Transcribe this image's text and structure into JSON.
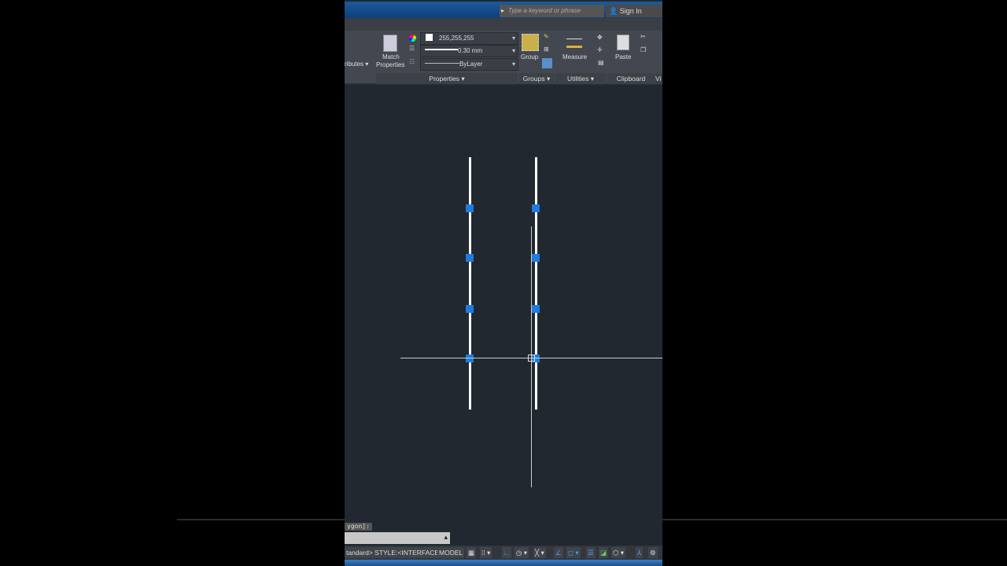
{
  "title_bar": {
    "search_placeholder": "Type a keyword or phrase",
    "sign_in": "Sign In"
  },
  "ribbon": {
    "attributes_partial": "ributes",
    "match_properties": [
      "Match",
      "Properties"
    ],
    "color_value": "255,255,255",
    "lineweight_value": "0.30 mm",
    "linetype_value": "ByLayer",
    "group_label": "Group",
    "measure_label": "Measure",
    "paste_label": "Paste",
    "panels": [
      "Properties",
      "Groups",
      "Utilities",
      "Clipboard",
      "Vi"
    ]
  },
  "command_line": {
    "prompt": "ygon]:",
    "input": ""
  },
  "status_bar": {
    "style_text": "tandard> STYLE:<INTERFACE>",
    "model": "MODEL"
  },
  "colors": {
    "grip": "#1e7be0",
    "canvas": "#212830"
  }
}
